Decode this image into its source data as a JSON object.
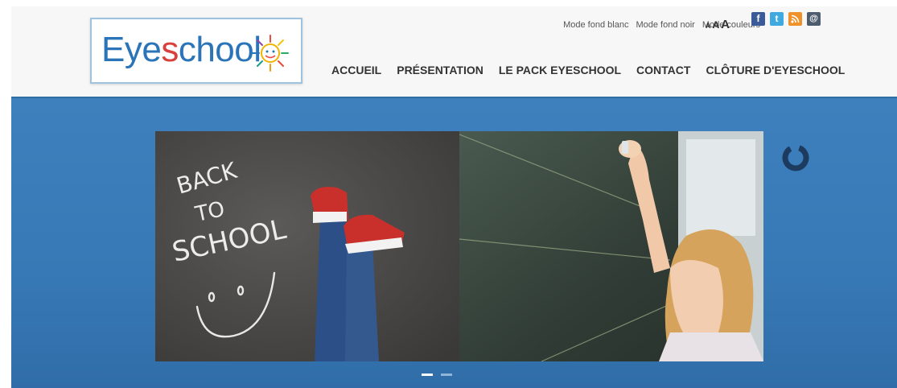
{
  "logo": {
    "text_pre": "Eye",
    "text_s": "s",
    "text_post": "chool"
  },
  "display_modes": [
    "Mode fond blanc",
    "Mode fond noir",
    "Mode couleurs"
  ],
  "font_sizes": [
    "A",
    "A",
    "A"
  ],
  "social": [
    {
      "icon": "facebook-icon",
      "glyph": "f"
    },
    {
      "icon": "twitter-icon",
      "glyph": "t"
    },
    {
      "icon": "rss-icon",
      "glyph": ")"
    },
    {
      "icon": "email-icon",
      "glyph": "@"
    }
  ],
  "nav": {
    "items": [
      "ACCUEIL",
      "PRÉSENTATION",
      "LE PACK EYESCHOOL",
      "CONTACT",
      "CLÔTURE D'EYESCHOOL"
    ]
  },
  "slider": {
    "chalk_lines": [
      "BACK",
      "TO",
      "SCHOOL"
    ],
    "active_index": 0,
    "total_slides": 2
  },
  "colors": {
    "brand_blue": "#2a74b7",
    "banner_blue": "#3779b6",
    "logo_accent": "#d8403b"
  }
}
